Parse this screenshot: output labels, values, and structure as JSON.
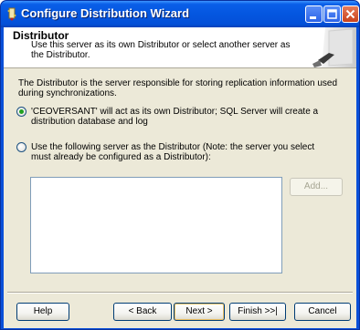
{
  "window": {
    "title": "Configure Distribution Wizard"
  },
  "header": {
    "title": "Distributor",
    "subtitle": "Use this server as its own Distributor or select another server as the Distributor."
  },
  "main": {
    "description": "The Distributor is the server responsible for storing replication information used during synchronizations.",
    "options": [
      {
        "label": "'CEOVERSANT' will act as its own Distributor; SQL Server will create a distribution database and log",
        "selected": true
      },
      {
        "label": "Use the following server as the Distributor (Note: the server you select must already be configured as a Distributor):",
        "selected": false
      }
    ],
    "add_button": "Add...",
    "server_list": []
  },
  "footer": {
    "help": "Help",
    "back": "< Back",
    "next": "Next >",
    "finish": "Finish >>|",
    "cancel": "Cancel"
  },
  "colors": {
    "titlebar": "#0456e0",
    "client_bg": "#ece9d8",
    "radio_check": "#21a121"
  }
}
